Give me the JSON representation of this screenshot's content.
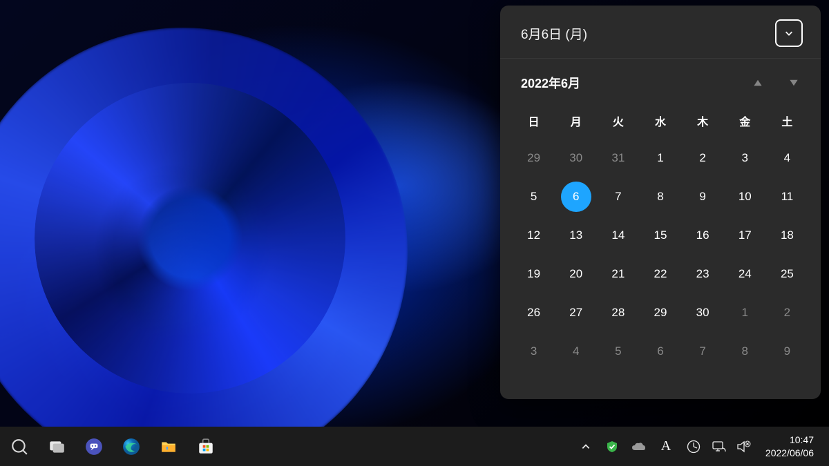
{
  "calendar": {
    "header_date": "6月6日 (月)",
    "month_label": "2022年6月",
    "weekdays": [
      "日",
      "月",
      "火",
      "水",
      "木",
      "金",
      "土"
    ],
    "today": 6,
    "rows": [
      [
        {
          "n": 29,
          "dim": true
        },
        {
          "n": 30,
          "dim": true
        },
        {
          "n": 31,
          "dim": true
        },
        {
          "n": 1
        },
        {
          "n": 2
        },
        {
          "n": 3
        },
        {
          "n": 4
        }
      ],
      [
        {
          "n": 5
        },
        {
          "n": 6,
          "today": true
        },
        {
          "n": 7
        },
        {
          "n": 8
        },
        {
          "n": 9
        },
        {
          "n": 10
        },
        {
          "n": 11
        }
      ],
      [
        {
          "n": 12
        },
        {
          "n": 13
        },
        {
          "n": 14
        },
        {
          "n": 15
        },
        {
          "n": 16
        },
        {
          "n": 17
        },
        {
          "n": 18
        }
      ],
      [
        {
          "n": 19
        },
        {
          "n": 20
        },
        {
          "n": 21
        },
        {
          "n": 22
        },
        {
          "n": 23
        },
        {
          "n": 24
        },
        {
          "n": 25
        }
      ],
      [
        {
          "n": 26
        },
        {
          "n": 27
        },
        {
          "n": 28
        },
        {
          "n": 29
        },
        {
          "n": 30
        },
        {
          "n": 1,
          "dim": true
        },
        {
          "n": 2,
          "dim": true
        }
      ],
      [
        {
          "n": 3,
          "dim": true
        },
        {
          "n": 4,
          "dim": true
        },
        {
          "n": 5,
          "dim": true
        },
        {
          "n": 6,
          "dim": true
        },
        {
          "n": 7,
          "dim": true
        },
        {
          "n": 8,
          "dim": true
        },
        {
          "n": 9,
          "dim": true
        }
      ]
    ]
  },
  "taskbar": {
    "time": "10:47",
    "date": "2022/06/06"
  },
  "colors": {
    "today_highlight": "#1ea5ff",
    "panel_bg": "#2b2b2b",
    "taskbar_bg": "#1c1c1c"
  }
}
